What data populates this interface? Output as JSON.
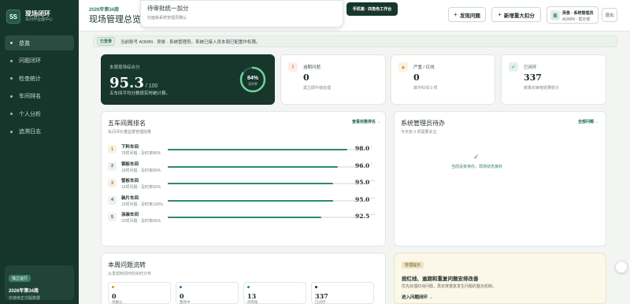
{
  "brand": {
    "logo": "5S",
    "name": "现场闭环",
    "subtitle": "车间作业面中心"
  },
  "sidebar": {
    "items": [
      {
        "label": "总览",
        "active": true
      },
      {
        "label": "问题闭环"
      },
      {
        "label": "检查统计"
      },
      {
        "label": "车间排名"
      },
      {
        "label": "个人分析"
      },
      {
        "label": "追溯日志"
      }
    ],
    "card": {
      "badge": "独立运行",
      "week": "2026年第34周",
      "note": "仅使用正式版数据"
    }
  },
  "header": {
    "week": "2026年第34周",
    "title": "现场管理总览",
    "toast_title": "待审批统一加分",
    "toast_sub": "仅面板系统管理员确认",
    "switch_label": "手机端 · 四角色工作台",
    "report_btn": "发现问题",
    "bonus_btn": "新增重大扣分",
    "user_avatar": "吴",
    "user_name": "吴俊 · 系统管理员",
    "user_role": "ADMIN · 帮办部",
    "logout": "退出"
  },
  "infobar": {
    "badge": "已登录",
    "text": "当前账号 ADMIN · 吴俊 · 系统管理员。系统已接入员本周已配置作权限。"
  },
  "score": {
    "label": "本周现场综合分",
    "value": "95.3",
    "of": "/ 100",
    "desc": "五车间平均分数按实时统计算。",
    "percent": 84,
    "ring_label": "及时率"
  },
  "stats": [
    {
      "icon": "!",
      "label": "逾期问题",
      "value": "0",
      "desc": "需立即升级处理",
      "icon_name": "alert-icon",
      "color": "#e05a4a",
      "bg": "#fdecea"
    },
    {
      "icon": "▲",
      "label": "严重 / 红线",
      "value": "0",
      "desc": "其中红线 0 项",
      "icon_name": "warning-icon",
      "color": "#d4932a",
      "bg": "#fbf1df"
    },
    {
      "icon": "✓",
      "label": "已闭环",
      "value": "337",
      "desc": "按真实审核结果统计",
      "icon_name": "check-icon",
      "color": "#2f8a63",
      "bg": "#e4f2ea"
    }
  ],
  "ranking": {
    "title": "五车间周排名",
    "subtitle": "车间评价量监督管理结果",
    "link": "查看完整排名 →",
    "rows": [
      {
        "rank": "1",
        "name": "下料车间",
        "meta": "78项问题 · 及时率86%",
        "score": "98.0",
        "trend": "↑"
      },
      {
        "rank": "2",
        "name": "钢板车间",
        "meta": "18项问题 · 及时率89%",
        "score": "96.0",
        "trend": "↑"
      },
      {
        "rank": "3",
        "name": "管板车间",
        "meta": "16项问题 · 及时率50%",
        "score": "95.0",
        "trend": "—"
      },
      {
        "rank": "4",
        "name": "装片车间",
        "meta": "15项问题 · 及时率100%",
        "score": "95.0",
        "trend": "—"
      },
      {
        "rank": "5",
        "name": "涂装车间",
        "meta": "20项问题 · 及时率65%",
        "score": "92.5",
        "trend": "—"
      }
    ]
  },
  "admin": {
    "title": "系统管理员待办",
    "subtitle": "今天有 0 项需要关注",
    "link": "全部问题 →",
    "empty_icon": "✓",
    "empty_text": "当前没有待办，现场状态良好"
  },
  "flow": {
    "title": "本周问题流转",
    "subtitle": "从发现到闭环的实时分布",
    "items": [
      {
        "value": "0",
        "label": "待确认",
        "color": "#d4932a"
      },
      {
        "value": "0",
        "label": "整改中",
        "color": "#2f6db5"
      },
      {
        "value": "13",
        "label": "待审核",
        "color": "#2f8a63"
      },
      {
        "value": "337",
        "label": "已闭环",
        "color": "#17362c"
      }
    ]
  },
  "tip": {
    "badge": "管理提示",
    "title": "按红线、逾期和重复问题安排改善",
    "desc": "优先处理红线问题，再安排重复发生问题的整治机制。",
    "link": "进入问题闭环 →"
  }
}
